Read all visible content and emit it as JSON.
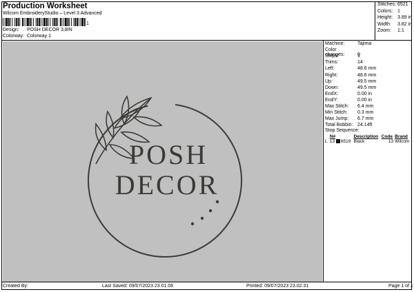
{
  "header": {
    "title": "Production Worksheet",
    "subtitle": "Wilcom EmbroideryStudio – Level 3 Advanced",
    "barcode_suffix": "1",
    "design_label": "Design:",
    "design_value": "POSH DECOR 3,8IN",
    "colorway_label": "Colorway:",
    "colorway_value": "Colorway 1"
  },
  "stats": [
    {
      "label": "Stitches:",
      "value": "6521"
    },
    {
      "label": "Colors:",
      "value": "1"
    },
    {
      "label": "Height:",
      "value": "3.89 in"
    },
    {
      "label": "Width:",
      "value": "3.82 in"
    },
    {
      "label": "Zoom:",
      "value": "1:1"
    }
  ],
  "machine_info": [
    {
      "label": "Machine:",
      "value": "Tajima"
    },
    {
      "label": "Color changes:",
      "value": "0"
    },
    {
      "label": "Stops:",
      "value": "1"
    },
    {
      "label": "Trims:",
      "value": "14"
    },
    {
      "label": "Left:",
      "value": "48.6 mm"
    },
    {
      "label": "Right:",
      "value": "48.6 mm"
    },
    {
      "label": "Up:",
      "value": "49.5 mm"
    },
    {
      "label": "Down:",
      "value": "49.5 mm"
    },
    {
      "label": "EndX:",
      "value": "0.00 in"
    },
    {
      "label": "EndY:",
      "value": "0.00 in"
    },
    {
      "label": "Max Stitch:",
      "value": "6.4 mm"
    },
    {
      "label": "Min Stitch:",
      "value": "0.3 mm"
    },
    {
      "label": "Max Jump:",
      "value": "6.7 mm"
    },
    {
      "label": "Total Bobbin:",
      "value": "24.14ft"
    }
  ],
  "stop_sequence": {
    "heading": "Stop Sequence:",
    "columns": [
      "N#",
      "Description",
      "Code",
      "Brand"
    ],
    "rows": [
      {
        "stop": "1.",
        "n": "13",
        "stitches": "6519",
        "description": "Black",
        "code": "13",
        "brand": "Wilcom"
      }
    ]
  },
  "design_preview": {
    "line1": "POSH",
    "line2": "DECOR",
    "thread_color": "#3b3a36",
    "background_color": "#c0c0c0"
  },
  "footer": {
    "created_by": "Created By:",
    "last_saved": "Last Saved: 09/07/2023 23.01.06",
    "printed": "Printed: 09/07/2023 23.02.31",
    "page": "Page 1 of 1"
  }
}
